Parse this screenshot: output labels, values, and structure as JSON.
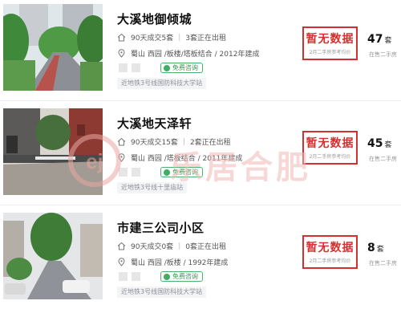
{
  "listings": [
    {
      "title": "大溪地御倾城",
      "deals": "90天成交5套",
      "renting": "3套正在出租",
      "details": "蜀山  西园  /板楼/塔板结合 / 2012年建成",
      "consult": "免费咨询",
      "metro": "近地铁3号线国防科技大学站",
      "price_status": "暂无数据",
      "price_note": "2月二手房参考均价",
      "on_sale_count": "47",
      "on_sale_unit": "套",
      "on_sale_label": "在售二手房"
    },
    {
      "title": "大溪地天泽轩",
      "deals": "90天成交15套",
      "renting": "2套正在出租",
      "details": "蜀山  西园  /塔板结合 / 2011年建成",
      "consult": "免费咨询",
      "metro": "近地铁3号线十里庙站",
      "price_status": "暂无数据",
      "price_note": "2月二手房参考均价",
      "on_sale_count": "45",
      "on_sale_unit": "套",
      "on_sale_label": "在售二手房"
    },
    {
      "title": "市建三公司小区",
      "deals": "90天成交0套",
      "renting": "0套正在出租",
      "details": "蜀山  西园  /板楼 / 1992年建成",
      "consult": "免费咨询",
      "metro": "近地铁3号线国防科技大学站",
      "price_status": "暂无数据",
      "price_note": "2月二手房参考均价",
      "on_sale_count": "8",
      "on_sale_unit": "套",
      "on_sale_label": "在售二手房"
    }
  ],
  "watermark": {
    "text": "乐居合肥"
  },
  "colors": {
    "accent_red": "#d3312f",
    "consult_green": "#49b26a"
  },
  "icons": {
    "deals": "house-icon",
    "location": "location-icon"
  }
}
